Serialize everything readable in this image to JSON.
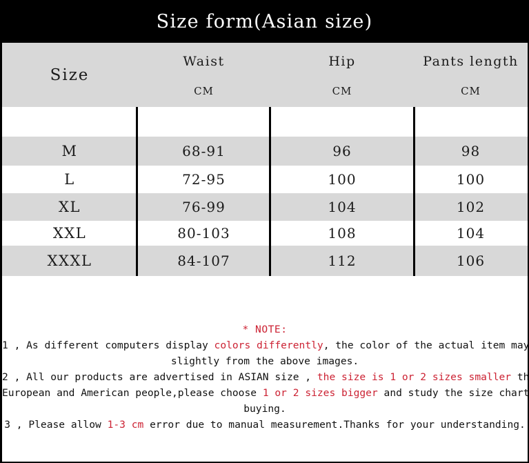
{
  "title": "Size form(Asian size)",
  "table": {
    "headers": {
      "size": "Size",
      "columns": [
        {
          "name": "Waist",
          "unit": "CM"
        },
        {
          "name": "Hip",
          "unit": "CM"
        },
        {
          "name": "Pants length",
          "unit": "CM"
        }
      ]
    },
    "rows": [
      {
        "size": "M",
        "waist": "68-91",
        "hip": "96",
        "length": "98"
      },
      {
        "size": "L",
        "waist": "72-95",
        "hip": "100",
        "length": "100"
      },
      {
        "size": "XL",
        "waist": "76-99",
        "hip": "104",
        "length": "102"
      },
      {
        "size": "XXL",
        "waist": "80-103",
        "hip": "108",
        "length": "104"
      },
      {
        "size": "XXXL",
        "waist": "84-107",
        "hip": "112",
        "length": "106"
      }
    ]
  },
  "notes": {
    "heading": "* NOTE:",
    "note1": {
      "part1": "1 , As different computers display ",
      "red1": "colors differently",
      "part2": ", the color of the actual item may vary",
      "part3": "slightly from the above images."
    },
    "note2": {
      "part1": "2 , All our products are advertised in ASIAN size , ",
      "red1": "the size is 1 or 2 sizes smaller",
      "part2": " than",
      "part3": "European and American people,please choose ",
      "red2": "1 or 2 sizes bigger",
      "part4": " and study the size chart before",
      "part5": "buying."
    },
    "note3": {
      "part1": "3 , Please allow ",
      "red1": "1-3 cm",
      "part2": " error due to manual measurement.Thanks for your understanding."
    }
  },
  "colors": {
    "title_bar": "#000000",
    "title_text": "#ffffff",
    "row_gray": "#d8d8d8",
    "row_white": "#ffffff",
    "accent_red": "#cc2233",
    "divider": "#000000"
  }
}
